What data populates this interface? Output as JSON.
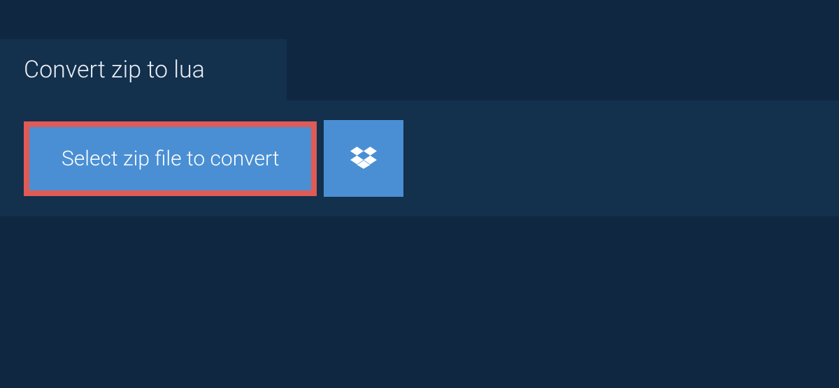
{
  "header": {
    "title": "Convert zip to lua"
  },
  "actions": {
    "select_file_label": "Select zip file to convert"
  },
  "colors": {
    "page_bg": "#0f2740",
    "panel_bg": "#13304d",
    "button_bg": "#4a8fd4",
    "highlight_border": "#e05a56",
    "text_light": "#e8eef4",
    "text_white": "#ffffff"
  }
}
